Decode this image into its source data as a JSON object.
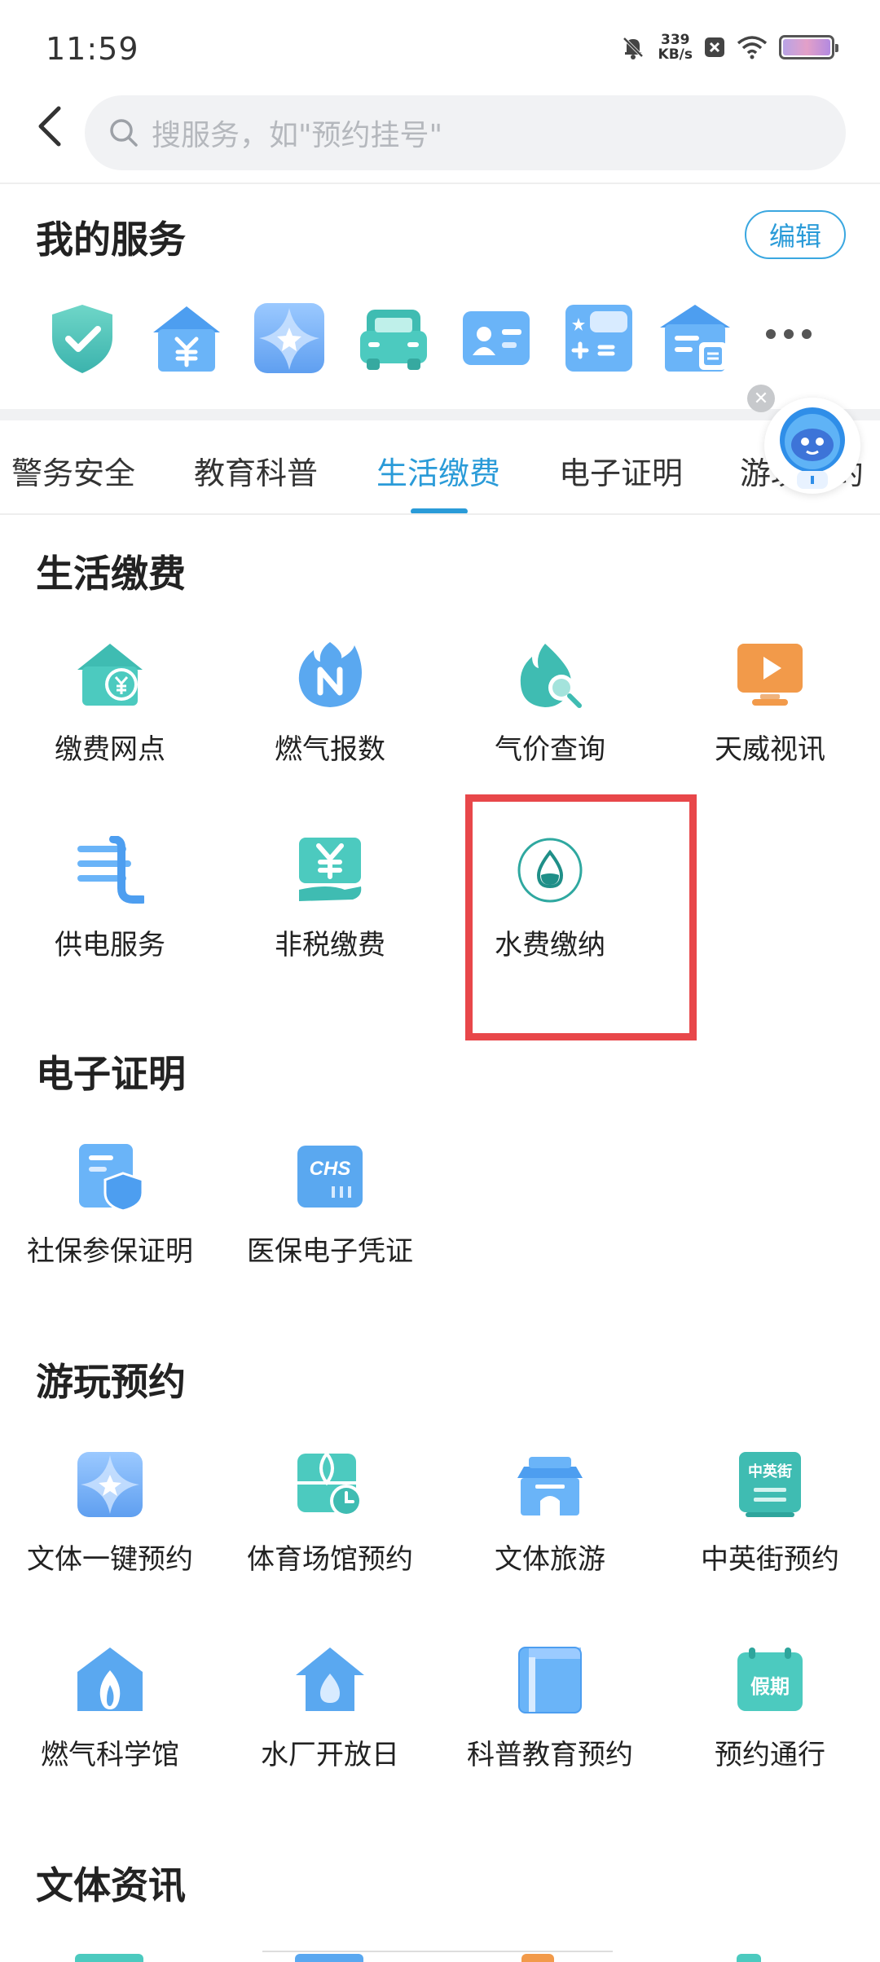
{
  "status_bar": {
    "time": "11:59",
    "net_speed_value": "339",
    "net_speed_unit": "KB/s"
  },
  "search": {
    "placeholder": "搜服务，如\"预约挂号\""
  },
  "my_services": {
    "title": "我的服务",
    "edit_label": "编辑",
    "quick_icons": [
      "shield-check-icon",
      "yuan-house-icon",
      "star-badge-icon",
      "car-icon",
      "id-card-icon",
      "calculator-icon",
      "building-list-icon"
    ]
  },
  "tabs": [
    {
      "label": "警务安全",
      "active": false
    },
    {
      "label": "教育科普",
      "active": false
    },
    {
      "label": "生活缴费",
      "active": true
    },
    {
      "label": "电子证明",
      "active": false
    },
    {
      "label": "游玩预约",
      "active": false
    }
  ],
  "sections": {
    "life_payment": {
      "title": "生活缴费",
      "items": [
        {
          "label": "缴费网点",
          "icon": "payment-point-icon"
        },
        {
          "label": "燃气报数",
          "icon": "gas-report-icon"
        },
        {
          "label": "气价查询",
          "icon": "gas-price-query-icon"
        },
        {
          "label": "天威视讯",
          "icon": "tv-play-icon"
        },
        {
          "label": "供电服务",
          "icon": "power-service-icon"
        },
        {
          "label": "非税缴费",
          "icon": "non-tax-payment-icon"
        },
        {
          "label": "水费缴纳",
          "icon": "water-drop-icon"
        }
      ]
    },
    "e_cert": {
      "title": "电子证明",
      "items": [
        {
          "label": "社保参保证明",
          "icon": "social-security-cert-icon"
        },
        {
          "label": "医保电子凭证",
          "icon": "chs-medical-cert-icon",
          "icon_text": "CHS"
        }
      ]
    },
    "leisure": {
      "title": "游玩预约",
      "items": [
        {
          "label": "文体一键预约",
          "icon": "star-booking-icon"
        },
        {
          "label": "体育场馆预约",
          "icon": "stadium-clock-icon"
        },
        {
          "label": "文体旅游",
          "icon": "gate-building-icon"
        },
        {
          "label": "中英街预约",
          "icon": "sign-board-icon",
          "icon_text": "中英街"
        },
        {
          "label": "燃气科学馆",
          "icon": "flame-house-icon"
        },
        {
          "label": "水厂开放日",
          "icon": "water-house-icon"
        },
        {
          "label": "科普教育预约",
          "icon": "book-icon"
        },
        {
          "label": "预约通行",
          "icon": "holiday-calendar-icon",
          "icon_text": "假期"
        }
      ]
    },
    "culture_news": {
      "title": "文体资讯"
    }
  },
  "colors": {
    "accent": "#2a9bd8",
    "icon_teal": "#4cc1b8",
    "icon_blue": "#5aa8f0",
    "highlight": "#e8474a"
  }
}
